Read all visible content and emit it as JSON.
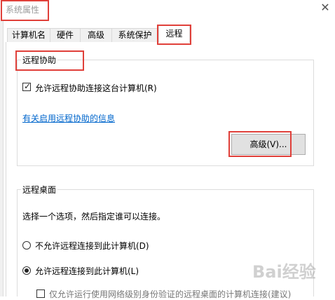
{
  "window": {
    "title": "系统属性",
    "close_icon": "close-icon"
  },
  "tabs": [
    {
      "label": "计算机名"
    },
    {
      "label": "硬件"
    },
    {
      "label": "高级"
    },
    {
      "label": "系统保护"
    },
    {
      "label": "远程"
    }
  ],
  "remote_assistance": {
    "group_label": "远程协助",
    "allow_checkbox_label": "允许远程协助连接这台计算机(R)",
    "allow_checked": true,
    "info_link": "有关启用远程协助的信息",
    "advanced_button": "高级(V)..."
  },
  "remote_desktop": {
    "group_label": "远程桌面",
    "instruction": "选择一个选项，然后指定谁可以连接。",
    "option_disallow": "不允许远程连接到此计算机(D)",
    "option_allow": "允许远程连接到此计算机(L)",
    "selected_option": "allow",
    "nla_option": "仅允许运行使用网络级别身份验证的远程桌面的计算机连接(建议)"
  },
  "watermark": "Bai经验"
}
